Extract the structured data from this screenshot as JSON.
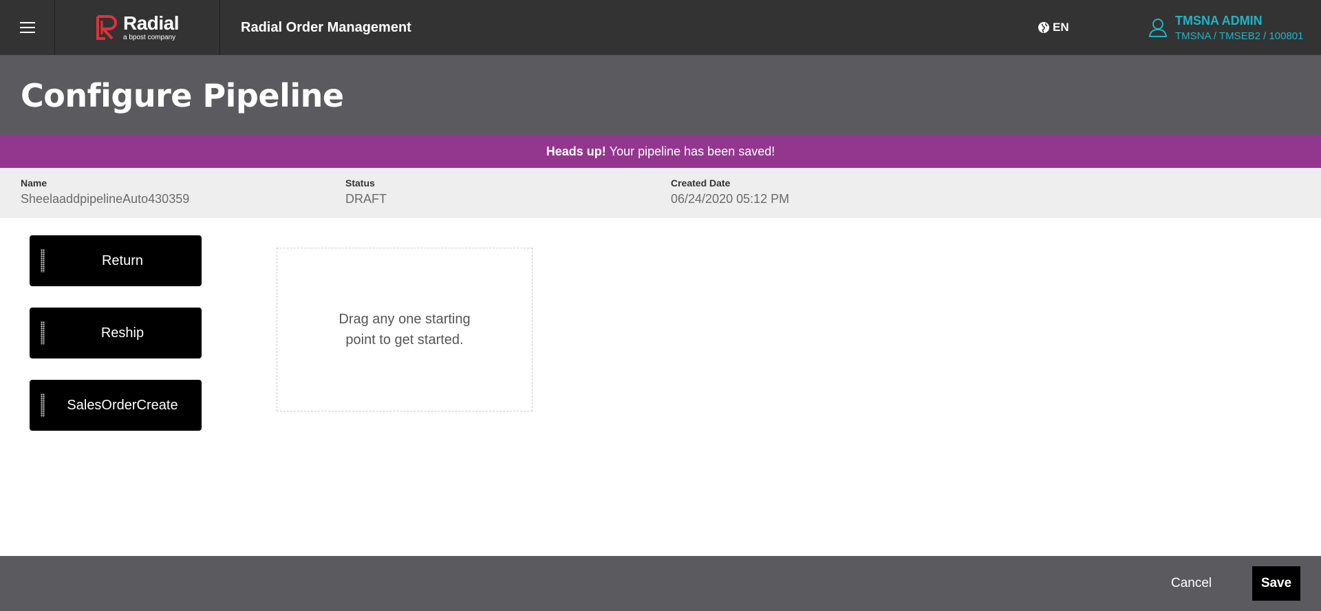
{
  "header": {
    "logo_word": "Radial",
    "logo_sub": "a bpost company",
    "app_title": "Radial Order Management",
    "language": "EN",
    "user_name": "TMSNA ADMIN",
    "user_context": "TMSNA / TMSEB2 / 100801",
    "icons": {
      "menu": "hamburger-menu-icon",
      "language": "globe-icon",
      "user": "user-icon"
    }
  },
  "page": {
    "title": "Configure Pipeline"
  },
  "alert": {
    "strong": "Heads up!",
    "message": "Your pipeline has been saved!"
  },
  "info": {
    "name_label": "Name",
    "name_value": "SheelaaddpipelineAuto430359",
    "status_label": "Status",
    "status_value": "DRAFT",
    "created_label": "Created Date",
    "created_value": "06/24/2020 05:12 PM"
  },
  "start_points": [
    {
      "label": "Return"
    },
    {
      "label": "Reship"
    },
    {
      "label": "SalesOrderCreate"
    }
  ],
  "dropzone": {
    "message": "Drag any one starting point to get started."
  },
  "footer": {
    "cancel_label": "Cancel",
    "save_label": "Save"
  },
  "colors": {
    "header_bg": "#333333",
    "title_band_bg": "#5b5b5f",
    "alert_bg": "#93368e",
    "brand_red": "#e0313c",
    "user_teal": "#1fb5c4"
  }
}
